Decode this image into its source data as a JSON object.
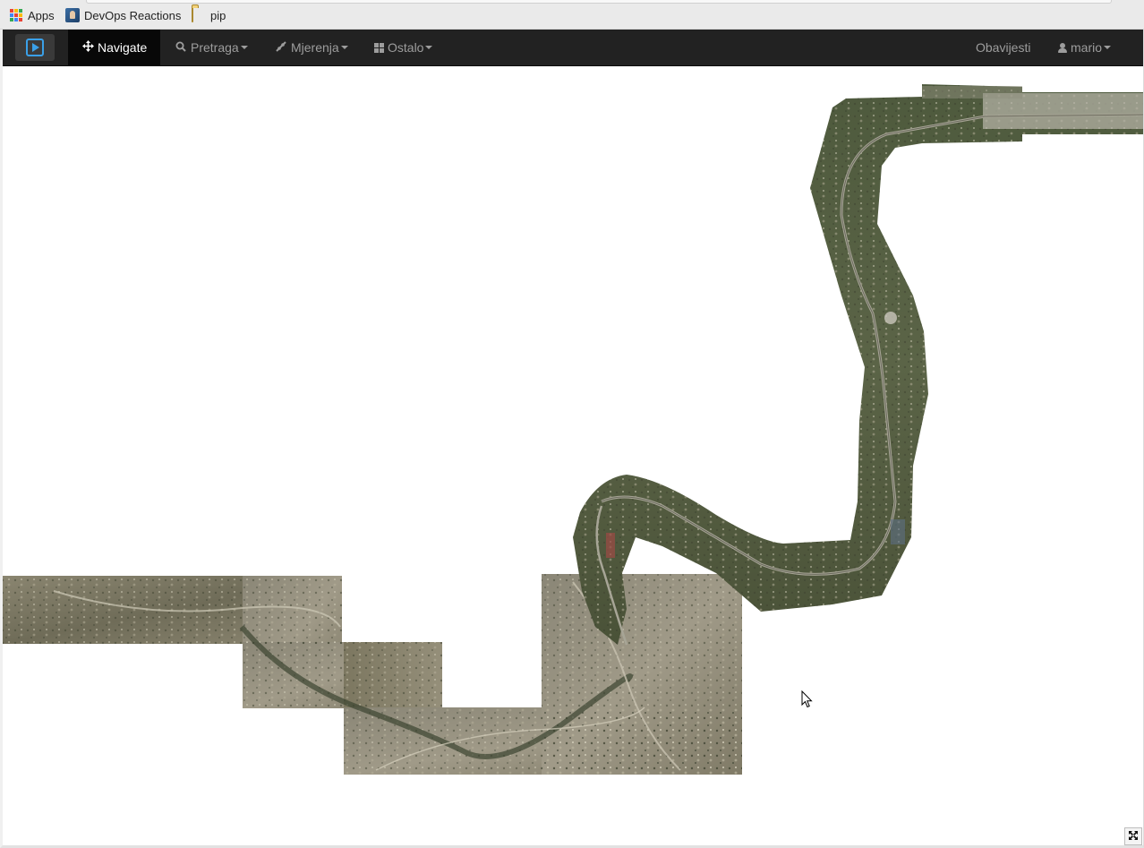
{
  "bookmarks": [
    {
      "label": "Apps",
      "icon": "apps-grid-icon"
    },
    {
      "label": "DevOps Reactions",
      "icon": "favicon-icon"
    },
    {
      "label": "pip",
      "icon": "folder-icon"
    }
  ],
  "navbar": {
    "brand_icon": "play-logo-icon",
    "items": [
      {
        "label": "Navigate",
        "icon": "move-arrows-icon",
        "active": true,
        "dropdown": false
      },
      {
        "label": "Pretraga",
        "icon": "search-icon",
        "active": false,
        "dropdown": true
      },
      {
        "label": "Mjerenja",
        "icon": "measure-icon",
        "active": false,
        "dropdown": true
      },
      {
        "label": "Ostalo",
        "icon": "grid-icon",
        "active": false,
        "dropdown": true
      }
    ],
    "right": {
      "notifications_label": "Obavijesti",
      "user_label": "mario"
    }
  },
  "map": {
    "layer": "aerial orthophoto tiles",
    "fullscreen_icon": "expand-icon"
  },
  "colors": {
    "navbar_bg": "#222222",
    "navbar_active_bg": "#080808",
    "navbar_text": "#9d9d9d",
    "brand_accent": "#3aa0e8"
  }
}
